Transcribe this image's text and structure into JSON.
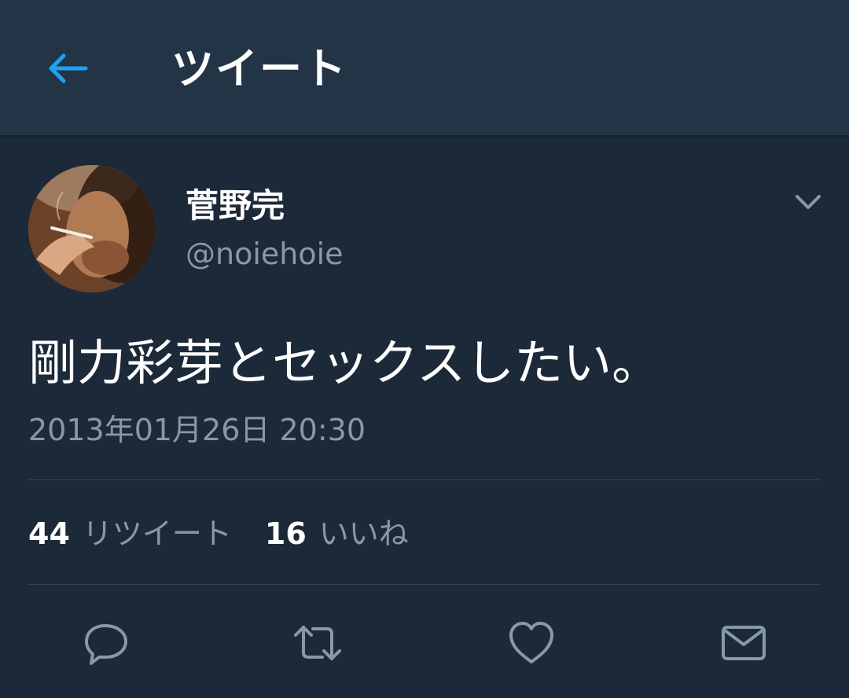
{
  "header": {
    "back_icon": "arrow-left-icon",
    "title": "ツイート",
    "accent": "#1da1f2"
  },
  "tweet": {
    "author": {
      "display_name": "菅野完",
      "handle": "@noiehoie"
    },
    "menu_icon": "chevron-down-icon",
    "text": "剛力彩芽とセックスしたい。",
    "timestamp": "2013年01月26日 20:30",
    "stats": {
      "retweets": {
        "count": "44",
        "label": "リツイート"
      },
      "likes": {
        "count": "16",
        "label": "いいね"
      }
    },
    "actions": [
      {
        "name": "reply",
        "icon": "reply-icon"
      },
      {
        "name": "retweet",
        "icon": "retweet-icon"
      },
      {
        "name": "like",
        "icon": "heart-icon"
      },
      {
        "name": "message",
        "icon": "mail-icon"
      }
    ]
  },
  "colors": {
    "background": "#1c2938",
    "header": "#243447",
    "secondary_text": "#8899a6",
    "divider": "#38444d"
  }
}
